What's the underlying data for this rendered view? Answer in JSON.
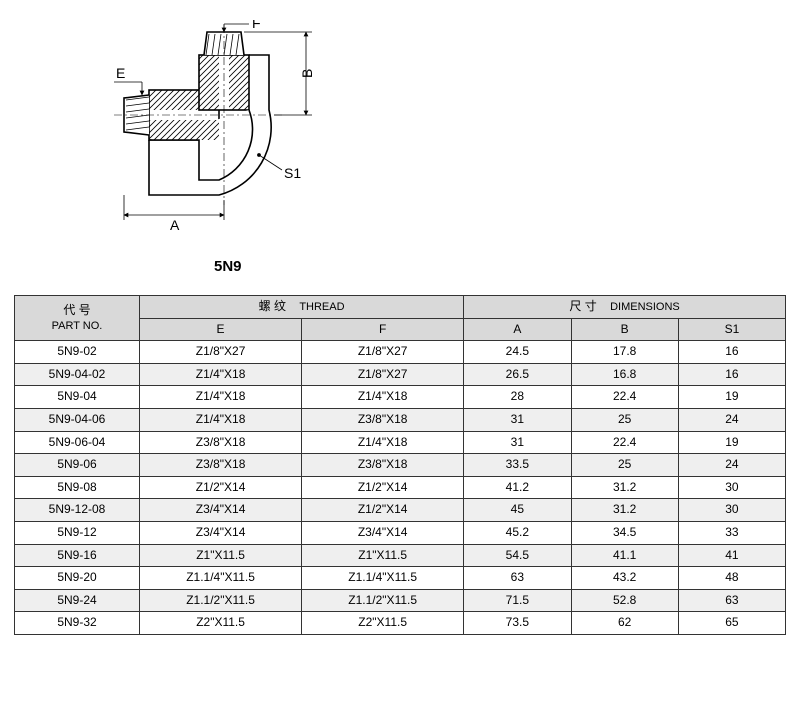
{
  "drawing": {
    "label_E": "E",
    "label_F": "F",
    "label_A": "A",
    "label_B": "B",
    "label_S1": "S1"
  },
  "title": "5N9",
  "headers": {
    "partno_cn": "代 号",
    "partno_en": "PART NO.",
    "thread_cn": "螺 纹",
    "thread_en": "THREAD",
    "dim_cn": "尺 寸",
    "dim_en": "DIMENSIONS",
    "E": "E",
    "F": "F",
    "A": "A",
    "B": "B",
    "S1": "S1"
  },
  "rows": [
    {
      "pn": "5N9-02",
      "E": "Z1/8\"X27",
      "F": "Z1/8\"X27",
      "A": "24.5",
      "B": "17.8",
      "S1": "16"
    },
    {
      "pn": "5N9-04-02",
      "E": "Z1/4\"X18",
      "F": "Z1/8\"X27",
      "A": "26.5",
      "B": "16.8",
      "S1": "16"
    },
    {
      "pn": "5N9-04",
      "E": "Z1/4\"X18",
      "F": "Z1/4\"X18",
      "A": "28",
      "B": "22.4",
      "S1": "19"
    },
    {
      "pn": "5N9-04-06",
      "E": "Z1/4\"X18",
      "F": "Z3/8\"X18",
      "A": "31",
      "B": "25",
      "S1": "24"
    },
    {
      "pn": "5N9-06-04",
      "E": "Z3/8\"X18",
      "F": "Z1/4\"X18",
      "A": "31",
      "B": "22.4",
      "S1": "19"
    },
    {
      "pn": "5N9-06",
      "E": "Z3/8\"X18",
      "F": "Z3/8\"X18",
      "A": "33.5",
      "B": "25",
      "S1": "24"
    },
    {
      "pn": "5N9-08",
      "E": "Z1/2\"X14",
      "F": "Z1/2\"X14",
      "A": "41.2",
      "B": "31.2",
      "S1": "30"
    },
    {
      "pn": "5N9-12-08",
      "E": "Z3/4\"X14",
      "F": "Z1/2\"X14",
      "A": "45",
      "B": "31.2",
      "S1": "30"
    },
    {
      "pn": "5N9-12",
      "E": "Z3/4\"X14",
      "F": "Z3/4\"X14",
      "A": "45.2",
      "B": "34.5",
      "S1": "33"
    },
    {
      "pn": "5N9-16",
      "E": "Z1\"X11.5",
      "F": "Z1\"X11.5",
      "A": "54.5",
      "B": "41.1",
      "S1": "41"
    },
    {
      "pn": "5N9-20",
      "E": "Z1.1/4\"X11.5",
      "F": "Z1.1/4\"X11.5",
      "A": "63",
      "B": "43.2",
      "S1": "48"
    },
    {
      "pn": "5N9-24",
      "E": "Z1.1/2\"X11.5",
      "F": "Z1.1/2\"X11.5",
      "A": "71.5",
      "B": "52.8",
      "S1": "63"
    },
    {
      "pn": "5N9-32",
      "E": "Z2\"X11.5",
      "F": "Z2\"X11.5",
      "A": "73.5",
      "B": "62",
      "S1": "65"
    }
  ]
}
